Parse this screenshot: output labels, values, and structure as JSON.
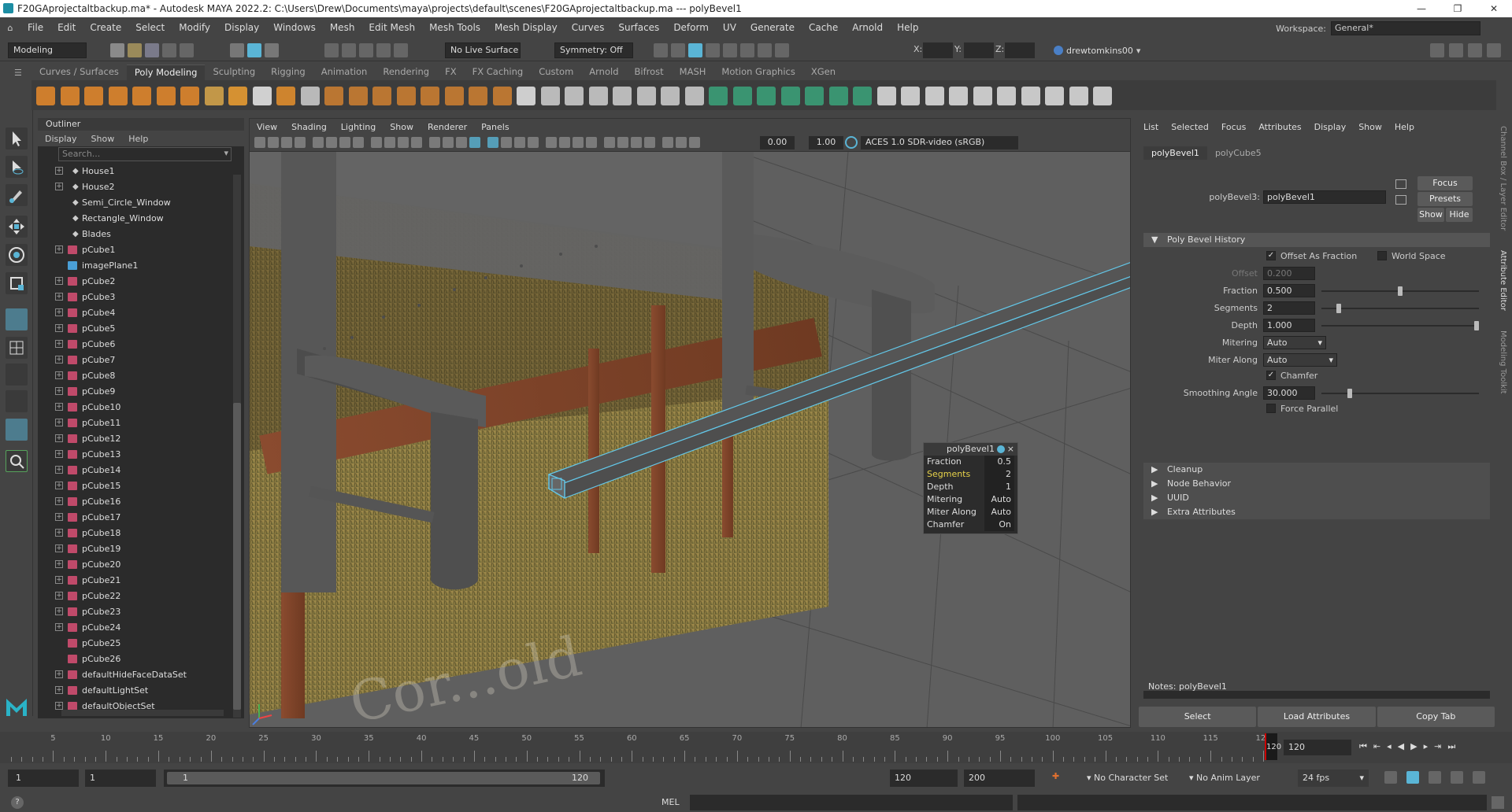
{
  "title": {
    "text": "F20GAprojectaltbackup.ma* - Autodesk MAYA 2022.2: C:\\Users\\Drew\\Documents\\maya\\projects\\default\\scenes\\F20GAprojectaltbackup.ma  ---  polyBevel1"
  },
  "menubar": [
    "File",
    "Edit",
    "Create",
    "Select",
    "Modify",
    "Display",
    "Windows",
    "Mesh",
    "Edit Mesh",
    "Mesh Tools",
    "Mesh Display",
    "Curves",
    "Surfaces",
    "Deform",
    "UV",
    "Generate",
    "Cache",
    "Arnold",
    "Help"
  ],
  "workspace": {
    "label": "Workspace:",
    "value": "General*"
  },
  "statusline": {
    "mode": "Modeling",
    "live_surface": "No Live Surface",
    "symmetry": "Symmetry: Off",
    "x_label": "X:",
    "y_label": "Y:",
    "z_label": "Z:",
    "user": "drewtomkins00"
  },
  "shelf_tabs": [
    "Curves / Surfaces",
    "Poly Modeling",
    "Sculpting",
    "Rigging",
    "Animation",
    "Rendering",
    "FX",
    "FX Caching",
    "Custom",
    "Arnold",
    "Bifrost",
    "MASH",
    "Motion Graphics",
    "XGen"
  ],
  "shelf_active": "Poly Modeling",
  "outliner": {
    "title": "Outliner",
    "menu": [
      "Display",
      "Show",
      "Help"
    ],
    "search_placeholder": "Search...",
    "items": [
      {
        "name": "House1",
        "expand": true,
        "kind": "group"
      },
      {
        "name": "House2",
        "expand": true,
        "kind": "group"
      },
      {
        "name": "Semi_Circle_Window",
        "expand": false,
        "kind": "group"
      },
      {
        "name": "Rectangle_Window",
        "expand": false,
        "kind": "group"
      },
      {
        "name": "Blades",
        "expand": false,
        "kind": "group"
      },
      {
        "name": "pCube1",
        "expand": true,
        "kind": "mesh"
      },
      {
        "name": "imagePlane1",
        "expand": false,
        "kind": "image"
      },
      {
        "name": "pCube2",
        "expand": true,
        "kind": "mesh"
      },
      {
        "name": "pCube3",
        "expand": true,
        "kind": "mesh"
      },
      {
        "name": "pCube4",
        "expand": true,
        "kind": "mesh"
      },
      {
        "name": "pCube5",
        "expand": true,
        "kind": "mesh"
      },
      {
        "name": "pCube6",
        "expand": true,
        "kind": "mesh"
      },
      {
        "name": "pCube7",
        "expand": true,
        "kind": "mesh"
      },
      {
        "name": "pCube8",
        "expand": true,
        "kind": "mesh"
      },
      {
        "name": "pCube9",
        "expand": true,
        "kind": "mesh"
      },
      {
        "name": "pCube10",
        "expand": true,
        "kind": "mesh"
      },
      {
        "name": "pCube11",
        "expand": true,
        "kind": "mesh"
      },
      {
        "name": "pCube12",
        "expand": true,
        "kind": "mesh"
      },
      {
        "name": "pCube13",
        "expand": true,
        "kind": "mesh"
      },
      {
        "name": "pCube14",
        "expand": true,
        "kind": "mesh"
      },
      {
        "name": "pCube15",
        "expand": true,
        "kind": "mesh"
      },
      {
        "name": "pCube16",
        "expand": true,
        "kind": "mesh"
      },
      {
        "name": "pCube17",
        "expand": true,
        "kind": "mesh"
      },
      {
        "name": "pCube18",
        "expand": true,
        "kind": "mesh"
      },
      {
        "name": "pCube19",
        "expand": true,
        "kind": "mesh"
      },
      {
        "name": "pCube20",
        "expand": true,
        "kind": "mesh"
      },
      {
        "name": "pCube21",
        "expand": true,
        "kind": "mesh"
      },
      {
        "name": "pCube22",
        "expand": true,
        "kind": "mesh"
      },
      {
        "name": "pCube23",
        "expand": true,
        "kind": "mesh"
      },
      {
        "name": "pCube24",
        "expand": true,
        "kind": "mesh"
      },
      {
        "name": "pCube25",
        "expand": false,
        "kind": "mesh"
      },
      {
        "name": "pCube26",
        "expand": false,
        "kind": "mesh"
      },
      {
        "name": "defaultHideFaceDataSet",
        "expand": true,
        "kind": "set"
      },
      {
        "name": "defaultLightSet",
        "expand": true,
        "kind": "set"
      },
      {
        "name": "defaultObjectSet",
        "expand": true,
        "kind": "set"
      }
    ]
  },
  "viewport": {
    "menu": [
      "View",
      "Shading",
      "Lighting",
      "Show",
      "Renderer",
      "Panels"
    ],
    "exposure": "0.00",
    "gamma": "1.00",
    "colorspace": "ACES 1.0 SDR-video (sRGB)"
  },
  "tool_settings": {
    "title": "polyBevel1",
    "rows": [
      {
        "label": "Fraction",
        "value": "0.5",
        "highlight": false
      },
      {
        "label": "Segments",
        "value": "2",
        "highlight": true
      },
      {
        "label": "Depth",
        "value": "1",
        "highlight": false
      },
      {
        "label": "Mitering",
        "value": "Auto",
        "highlight": false
      },
      {
        "label": "Miter Along",
        "value": "Auto",
        "highlight": false
      },
      {
        "label": "Chamfer",
        "value": "On",
        "highlight": false
      }
    ]
  },
  "attribute_editor": {
    "menu": [
      "List",
      "Selected",
      "Focus",
      "Attributes",
      "Display",
      "Show",
      "Help"
    ],
    "tabs": [
      "polyBevel1",
      "polyCube5"
    ],
    "node_label": "polyBevel3:",
    "node_value": "polyBevel1",
    "buttons": {
      "focus": "Focus",
      "presets": "Presets",
      "show": "Show",
      "hide": "Hide"
    },
    "section_title": "Poly Bevel History",
    "offset_as_fraction": "Offset As Fraction",
    "world_space": "World Space",
    "offset": {
      "label": "Offset",
      "value": "0.200"
    },
    "fraction": {
      "label": "Fraction",
      "value": "0.500",
      "slider": 0.5
    },
    "segments": {
      "label": "Segments",
      "value": "2",
      "slider": 0.1
    },
    "depth": {
      "label": "Depth",
      "value": "1.000",
      "slider": 1.0
    },
    "mitering": {
      "label": "Mitering",
      "value": "Auto"
    },
    "miter_along": {
      "label": "Miter Along",
      "value": "Auto"
    },
    "chamfer": "Chamfer",
    "smoothing_angle": {
      "label": "Smoothing Angle",
      "value": "30.000",
      "slider": 0.17
    },
    "force_parallel": "Force Parallel",
    "collapsed_sections": [
      "Cleanup",
      "Node Behavior",
      "UUID",
      "Extra Attributes"
    ],
    "notes": "Notes:  polyBevel1",
    "bottom_buttons": [
      "Select",
      "Load Attributes",
      "Copy Tab"
    ]
  },
  "side_tabs": [
    "Channel Box / Layer Editor",
    "Attribute Editor",
    "Modeling Toolkit"
  ],
  "timeline": {
    "ticks": [
      5,
      10,
      15,
      20,
      25,
      30,
      35,
      40,
      45,
      50,
      55,
      60,
      65,
      70,
      75,
      80,
      85,
      90,
      95,
      100,
      105,
      110,
      115,
      120
    ],
    "current_frame": "120",
    "frame_field": "120"
  },
  "range": {
    "start": "1",
    "start2": "1",
    "slider_start": "1",
    "slider_end": "120",
    "end": "120",
    "end2": "200",
    "character_set": "No Character Set",
    "anim_layer": "No Anim Layer",
    "fps": "24 fps"
  },
  "cmdline": {
    "lang": "MEL"
  },
  "colors": {
    "accent": "#5ab5d6",
    "selection": "#63c7e8",
    "highlight_text": "#e7d24a"
  }
}
